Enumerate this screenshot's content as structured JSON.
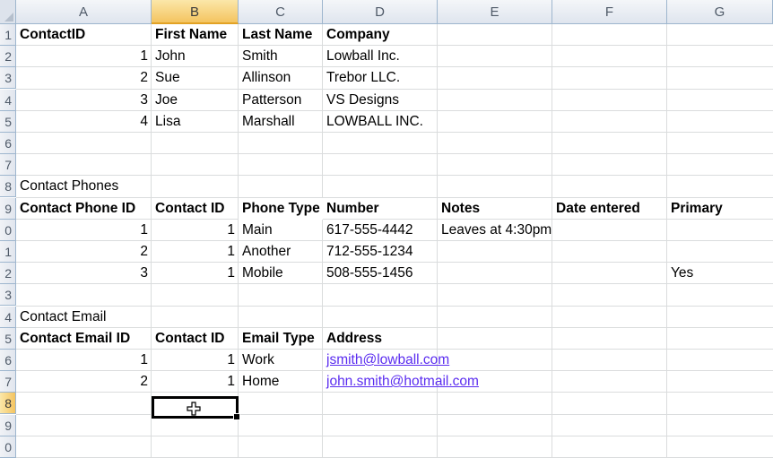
{
  "column_headers": [
    "A",
    "B",
    "C",
    "D",
    "E",
    "F",
    "G"
  ],
  "row_headers": [
    "1",
    "2",
    "3",
    "4",
    "5",
    "6",
    "7",
    "8",
    "9",
    "0",
    "1",
    "2",
    "3",
    "4",
    "5",
    "6",
    "7",
    "8",
    "9",
    "0"
  ],
  "active_column": "B",
  "active_row_label": "8",
  "colors": {
    "hyperlink": "#5a2cf0",
    "active_header": "#f4c460",
    "gridline": "#dadcdd"
  },
  "contacts": {
    "headers": [
      "ContactID",
      "First Name",
      "Last Name",
      "Company"
    ],
    "rows": [
      [
        "1",
        "John",
        "Smith",
        "Lowball Inc."
      ],
      [
        "2",
        "Sue",
        "Allinson",
        "Trebor LLC."
      ],
      [
        "3",
        "Joe",
        "Patterson",
        "VS Designs"
      ],
      [
        "4",
        "Lisa",
        "Marshall",
        "LOWBALL INC."
      ]
    ]
  },
  "phones": {
    "section_title": "Contact Phones",
    "headers": [
      "Contact Phone ID",
      "Contact ID",
      "Phone Type",
      "Number",
      "Notes",
      "Date entered",
      "Primary"
    ],
    "rows": [
      [
        "1",
        "1",
        "Main",
        "617-555-4442",
        "Leaves at 4:30pm",
        "",
        ""
      ],
      [
        "2",
        "1",
        "Another",
        "712-555-1234",
        "",
        "",
        ""
      ],
      [
        "3",
        "1",
        "Mobile",
        "508-555-1456",
        "",
        "",
        "Yes"
      ]
    ]
  },
  "emails": {
    "section_title": "Contact Email",
    "headers": [
      "Contact Email ID",
      "Contact ID",
      "Email Type",
      "Address"
    ],
    "rows": [
      [
        "1",
        "1",
        "Work",
        "jsmith@lowball.com"
      ],
      [
        "2",
        "1",
        "Home",
        "john.smith@hotmail.com"
      ]
    ]
  }
}
